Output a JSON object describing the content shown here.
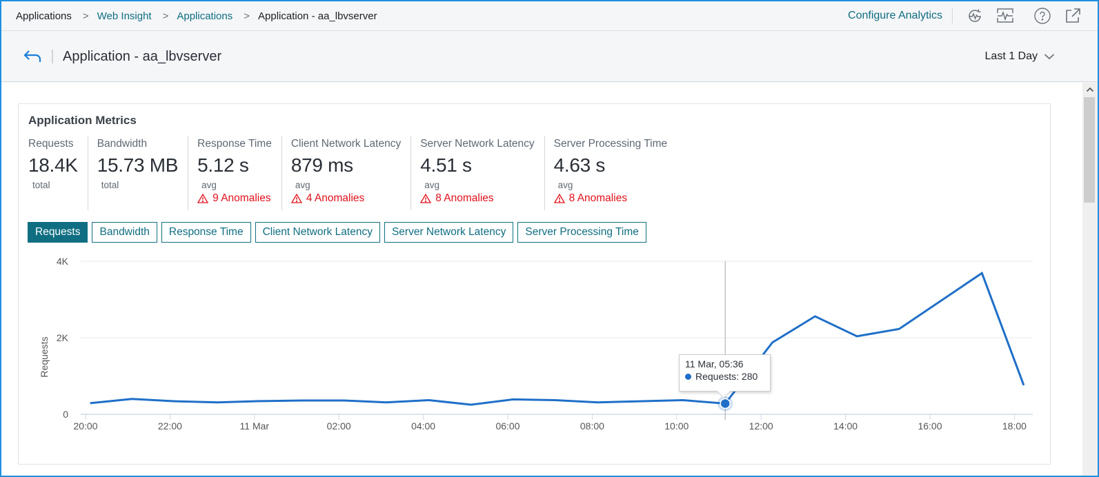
{
  "breadcrumb": [
    {
      "label": "Applications",
      "link": false
    },
    {
      "label": "Web Insight",
      "link": true
    },
    {
      "label": "Applications",
      "link": true
    },
    {
      "label": "Application - aa_lbvserver",
      "link": false
    }
  ],
  "topbar": {
    "configure_label": "Configure Analytics",
    "icons": [
      "refresh-pulse-icon",
      "monitor-pulse-icon",
      "help-icon",
      "external-link-icon"
    ]
  },
  "header": {
    "title": "Application - aa_lbvserver",
    "time_range": "Last 1 Day"
  },
  "card": {
    "title": "Application Metrics",
    "metrics": [
      {
        "label": "Requests",
        "value": "18.4K",
        "sub": "total",
        "anomalies": null
      },
      {
        "label": "Bandwidth",
        "value": "15.73 MB",
        "sub": "total",
        "anomalies": null
      },
      {
        "label": "Response Time",
        "value": "5.12 s",
        "sub": "avg",
        "anomalies": "9 Anomalies"
      },
      {
        "label": "Client Network Latency",
        "value": "879 ms",
        "sub": "avg",
        "anomalies": "4 Anomalies"
      },
      {
        "label": "Server Network Latency",
        "value": "4.51 s",
        "sub": "avg",
        "anomalies": "8 Anomalies"
      },
      {
        "label": "Server Processing Time",
        "value": "4.63 s",
        "sub": "avg",
        "anomalies": "8 Anomalies"
      }
    ],
    "tabs": [
      {
        "label": "Requests",
        "active": true
      },
      {
        "label": "Bandwidth",
        "active": false
      },
      {
        "label": "Response Time",
        "active": false
      },
      {
        "label": "Client Network Latency",
        "active": false
      },
      {
        "label": "Server Network Latency",
        "active": false
      },
      {
        "label": "Server Processing Time",
        "active": false
      }
    ]
  },
  "tooltip": {
    "title": "11 Mar, 05:36",
    "series_label": "Requests: 280"
  },
  "colors": {
    "accent": "#0f6e82",
    "line": "#1f6fc8",
    "anomaly": "#e0111b"
  },
  "chart_data": {
    "type": "line",
    "title": "",
    "xlabel": "",
    "ylabel": "Requests",
    "ylim": [
      0,
      4000
    ],
    "yticks": [
      0,
      2000,
      4000
    ],
    "ytick_labels": [
      "0",
      "2K",
      "4K"
    ],
    "xlim_hours": [
      -0.1,
      22.5
    ],
    "xticks_hours": [
      0,
      2,
      4,
      6,
      8,
      10,
      12,
      14,
      16,
      18,
      20,
      22
    ],
    "xtick_labels": [
      "20:00",
      "22:00",
      "11 Mar",
      "02:00",
      "04:00",
      "06:00",
      "08:00",
      "10:00",
      "12:00",
      "14:00",
      "16:00",
      "18:00"
    ],
    "grid": true,
    "legend": "none",
    "series": [
      {
        "name": "Requests",
        "x_hours": [
          0.11,
          1.1,
          2.12,
          3.13,
          4.13,
          5.13,
          6.13,
          7.12,
          8.13,
          9.13,
          10.13,
          11.12,
          12.13,
          13.13,
          14.15,
          15.15,
          16.27,
          17.28,
          18.27,
          19.27,
          21.23,
          22.22
        ],
        "values": [
          290,
          400,
          340,
          310,
          345,
          360,
          360,
          310,
          370,
          250,
          390,
          370,
          310,
          340,
          370,
          280,
          1880,
          2560,
          2040,
          2230,
          3690,
          760
        ]
      }
    ],
    "highlight": {
      "index": 15,
      "label": "11 Mar, 05:36",
      "value": 280
    }
  }
}
